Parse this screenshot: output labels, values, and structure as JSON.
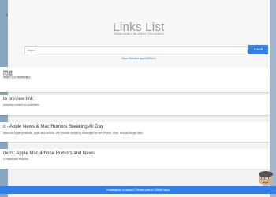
{
  "header": {
    "title": "Links List",
    "subtitle": "Simply create a list of links. Then share it."
  },
  "search": {
    "placeholder": "https://"
  },
  "add_button": {
    "label": "ADD"
  },
  "share_link": "https://linkslist.app/id/5f0d1c",
  "cards": [
    {
      "title": "問道",
      "desc": "問道的日記與網路筆記"
    },
    {
      "title": "to preview link",
      "desc": "property content of undefined"
    },
    {
      "title": "c - Apple News & Mac Rumors Breaking All Day",
      "desc": "ation for Apple products, apps and rumors. We provide breaking coverage for the iPhone, iPad, and all things Mac!"
    },
    {
      "title": "mors: Apple Mac iPhone Rumors and News",
      "desc": "S News and Rumors"
    }
  ],
  "footer": {
    "text": "Suggestions or issues? Please open a GitHub issue"
  },
  "colors": {
    "accent": "#2f80ed"
  }
}
